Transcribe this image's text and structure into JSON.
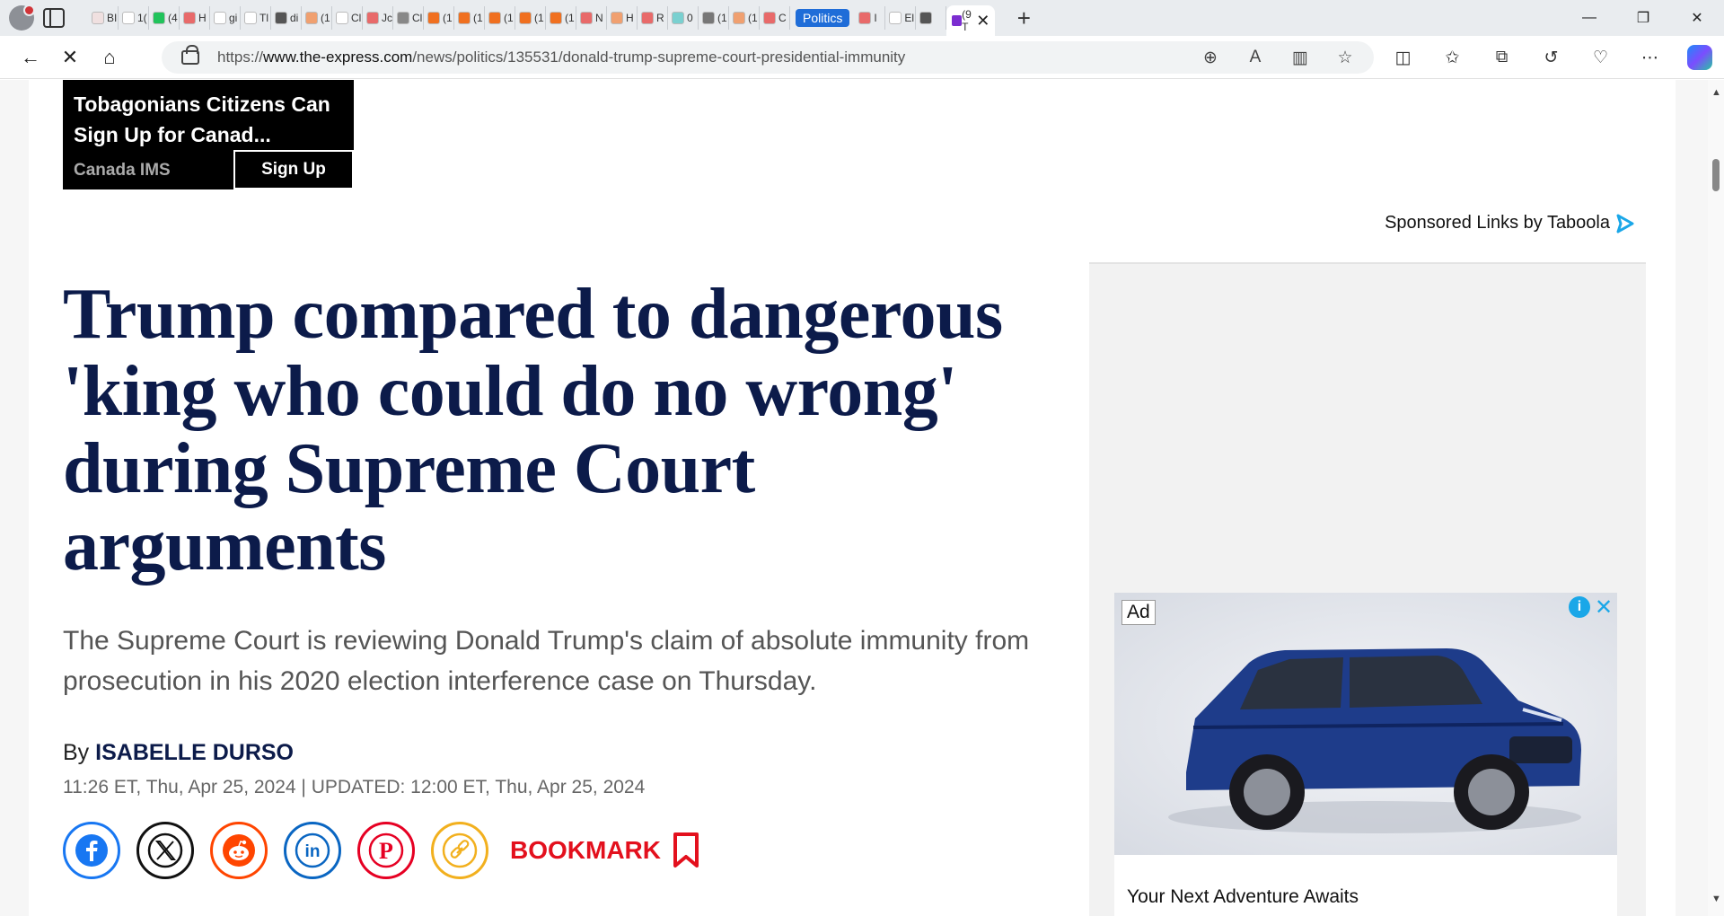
{
  "browser": {
    "url_prefix": "https://",
    "url_domain": "www.the-express.com",
    "url_path": "/news/politics/135531/donald-trump-supreme-court-presidential-immunity",
    "highlighted_tab_label": "Politics",
    "mini_tabs": [
      {
        "ch": "BI",
        "color": "#f0e0e0"
      },
      {
        "ch": "1(",
        "color": "#ffffff"
      },
      {
        "ch": "(4",
        "color": "#21c35b"
      },
      {
        "ch": "H",
        "color": "#e86a6a"
      },
      {
        "ch": "gi",
        "color": "#ffffff"
      },
      {
        "ch": "Tl",
        "color": "#ffffff"
      },
      {
        "ch": "di",
        "color": "#555555"
      },
      {
        "ch": "(1",
        "color": "#f0a070"
      },
      {
        "ch": "Cl",
        "color": "#ffffff"
      },
      {
        "ch": "Jc",
        "color": "#e86a6a"
      },
      {
        "ch": "Cl",
        "color": "#888888"
      },
      {
        "ch": "(1",
        "color": "#f07020"
      },
      {
        "ch": "(1",
        "color": "#f07020"
      },
      {
        "ch": "(1",
        "color": "#f07020"
      },
      {
        "ch": "(1",
        "color": "#f07020"
      },
      {
        "ch": "(1",
        "color": "#f07020"
      },
      {
        "ch": "N",
        "color": "#e86a6a"
      },
      {
        "ch": "H",
        "color": "#f0a070"
      },
      {
        "ch": "R",
        "color": "#e86a6a"
      },
      {
        "ch": "0",
        "color": "#7ad0d0"
      },
      {
        "ch": "(1",
        "color": "#777777"
      },
      {
        "ch": "(1",
        "color": "#f0a070"
      },
      {
        "ch": "C",
        "color": "#e86a6a"
      }
    ],
    "after_tabs": [
      {
        "ch": "I",
        "color": "#e86a6a"
      },
      {
        "ch": "El",
        "color": "#ffffff"
      },
      {
        "ch": "",
        "color": "#555555"
      }
    ],
    "active_tab_ch": "(9",
    "active_tab_second": "T",
    "active_tab_color": "#7b2dd0"
  },
  "top_ad": {
    "text": "Tobagonians Citizens Can Sign Up for Canad...",
    "source": "Canada IMS",
    "cta": "Sign Up"
  },
  "taboola": {
    "label": "Sponsored Links by Taboola"
  },
  "article": {
    "headline": "Trump compared to dangerous 'king who could do no wrong' during Supreme Court arguments",
    "standfirst": "The Supreme Court is reviewing Donald Trump's claim of absolute immunity from prosecution in his 2020 election interference case on Thursday.",
    "by": "By",
    "author": "ISABELLE DURSO",
    "dateline": "11:26 ET, Thu, Apr 25, 2024 | UPDATED: 12:00 ET, Thu, Apr 25, 2024",
    "bookmark_label": "BOOKMARK"
  },
  "side_ad": {
    "label": "Ad",
    "info": "i",
    "close": "✕",
    "caption": "Your Next Adventure Awaits"
  },
  "share_icons": [
    {
      "name": "facebook-icon",
      "color": "#1877f2"
    },
    {
      "name": "x-icon",
      "color": "#111111"
    },
    {
      "name": "reddit-icon",
      "color": "#ff4500"
    },
    {
      "name": "linkedin-icon",
      "color": "#0a66c2"
    },
    {
      "name": "pinterest-icon",
      "color": "#e60023"
    },
    {
      "name": "copy-link-icon",
      "color": "#f2b01e"
    }
  ],
  "colors": {
    "headline": "#0c1b4a",
    "bookmark": "#e3101d",
    "taboola_accent": "#1aa7e8"
  }
}
